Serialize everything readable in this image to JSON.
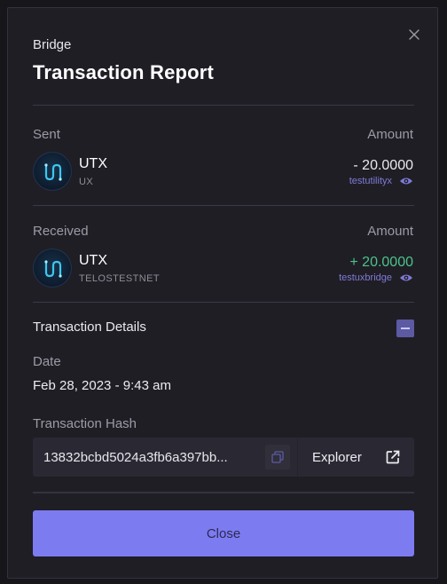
{
  "header": {
    "subtitle": "Bridge",
    "title": "Transaction Report"
  },
  "sent": {
    "label": "Sent",
    "amount_label": "Amount",
    "token": "UTX",
    "chain": "UX",
    "amount": "- 20.0000",
    "account": "testutilityx"
  },
  "received": {
    "label": "Received",
    "amount_label": "Amount",
    "token": "UTX",
    "chain": "TELOSTESTNET",
    "amount": "+ 20.0000",
    "account": "testuxbridge"
  },
  "details": {
    "title": "Transaction Details",
    "date_label": "Date",
    "date_value": "Feb 28, 2023 - 9:43 am",
    "hash_label": "Transaction Hash",
    "hash_value": "13832bcbd5024a3fb6a397bb...",
    "explorer_label": "Explorer"
  },
  "footer": {
    "close_label": "Close"
  },
  "colors": {
    "accent": "#7d7bf0",
    "positive": "#4cc38a",
    "link": "#7e7bd6",
    "background": "#1f1e25"
  },
  "icons": {
    "close": "close-icon",
    "token_logo": "utx-logo-icon",
    "view": "eye-icon",
    "collapse": "minus-icon",
    "copy": "copy-icon",
    "external": "external-link-icon"
  }
}
